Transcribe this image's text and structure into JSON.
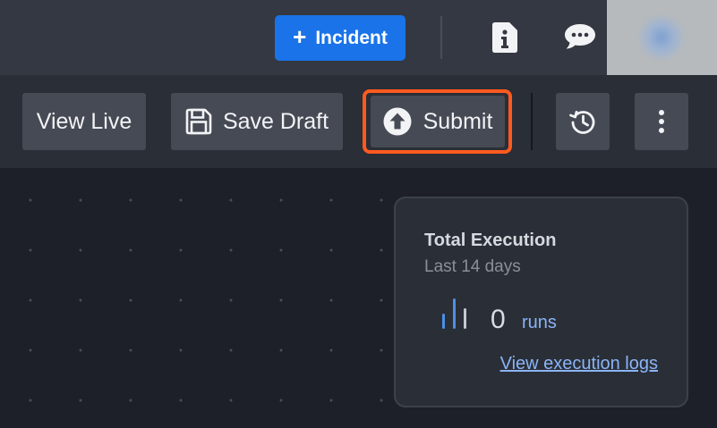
{
  "topbar": {
    "incident_button": {
      "icon": "plus-icon",
      "label": "Incident"
    },
    "icons": [
      "info-icon",
      "chat-icon"
    ],
    "avatar": "user-avatar"
  },
  "toolbar": {
    "view_live_label": "View Live",
    "save_draft": {
      "icon": "floppy-disk-icon",
      "label": "Save Draft"
    },
    "submit": {
      "icon": "upload-arrow-icon",
      "label": "Submit",
      "highlighted": true
    },
    "history_icon": "history-clock-icon",
    "more_icon": "more-vertical-icon"
  },
  "card": {
    "title": "Total Execution",
    "subtitle": "Last 14 days",
    "icon": "bar-chart-icon",
    "count": "0",
    "unit": "runs",
    "link": "View execution logs"
  },
  "colors": {
    "accent_blue": "#1a73e8",
    "highlight_orange": "#ff5a1f",
    "link_blue": "#8ab4f8"
  }
}
